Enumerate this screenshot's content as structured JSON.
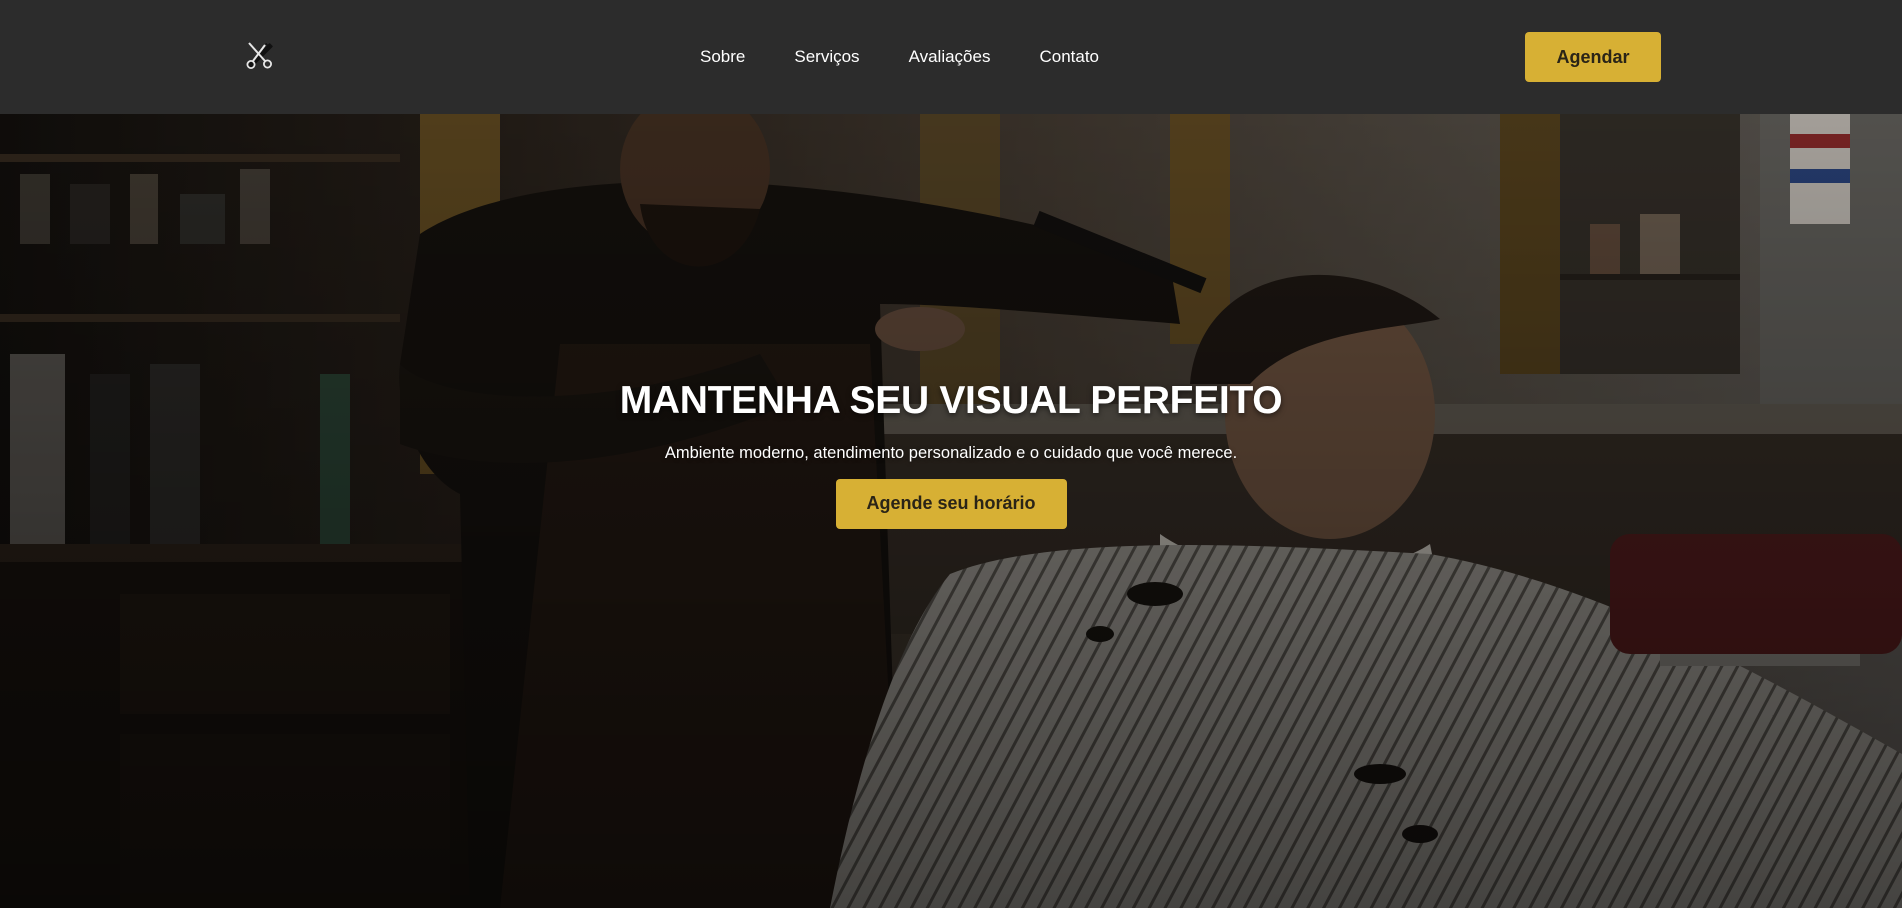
{
  "header": {
    "logo_icon": "scissors-comb-icon",
    "nav": [
      {
        "label": "Sobre"
      },
      {
        "label": "Serviços"
      },
      {
        "label": "Avaliações"
      },
      {
        "label": "Contato"
      }
    ],
    "cta_label": "Agendar"
  },
  "hero": {
    "background": "barber-cutting-hair-photo",
    "title": "MANTENHA SEU VISUAL PERFEITO",
    "subtitle": "Ambiente moderno, atendimento personalizado e o cuidado que você merece.",
    "cta_label": "Agende seu horário"
  },
  "colors": {
    "header_bg": "#2c2c2c",
    "accent": "#d7b034",
    "accent_text": "#2a2417",
    "text_light": "#ffffff"
  }
}
